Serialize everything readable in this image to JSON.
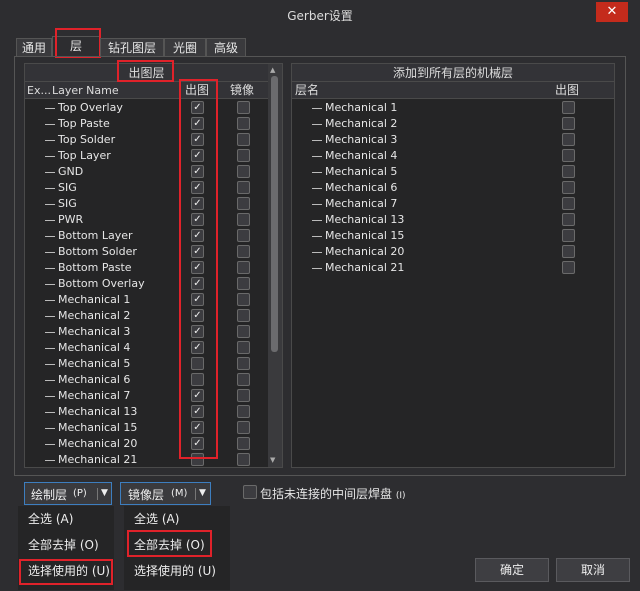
{
  "window": {
    "title": "Gerber设置",
    "close_glyph": "✕"
  },
  "tabs": [
    "通用",
    "层",
    "钻孔图层",
    "光圈",
    "高级"
  ],
  "left_panel": {
    "group_header": "出图层",
    "col_expand": "Ex...",
    "col_name": "Layer Name",
    "col_plot": "出图",
    "col_mirror": "镜像",
    "layers": [
      {
        "name": "Top Overlay",
        "plot": true,
        "mirror": false
      },
      {
        "name": "Top Paste",
        "plot": true,
        "mirror": false
      },
      {
        "name": "Top Solder",
        "plot": true,
        "mirror": false
      },
      {
        "name": "Top Layer",
        "plot": true,
        "mirror": false
      },
      {
        "name": "GND",
        "plot": true,
        "mirror": false
      },
      {
        "name": "SIG",
        "plot": true,
        "mirror": false
      },
      {
        "name": "SIG",
        "plot": true,
        "mirror": false
      },
      {
        "name": "PWR",
        "plot": true,
        "mirror": false
      },
      {
        "name": "Bottom Layer",
        "plot": true,
        "mirror": false
      },
      {
        "name": "Bottom Solder",
        "plot": true,
        "mirror": false
      },
      {
        "name": "Bottom Paste",
        "plot": true,
        "mirror": false
      },
      {
        "name": "Bottom Overlay",
        "plot": true,
        "mirror": false
      },
      {
        "name": "Mechanical 1",
        "plot": true,
        "mirror": false
      },
      {
        "name": "Mechanical 2",
        "plot": true,
        "mirror": false
      },
      {
        "name": "Mechanical 3",
        "plot": true,
        "mirror": false
      },
      {
        "name": "Mechanical 4",
        "plot": true,
        "mirror": false
      },
      {
        "name": "Mechanical 5",
        "plot": false,
        "mirror": false
      },
      {
        "name": "Mechanical 6",
        "plot": false,
        "mirror": false
      },
      {
        "name": "Mechanical 7",
        "plot": true,
        "mirror": false
      },
      {
        "name": "Mechanical 13",
        "plot": true,
        "mirror": false
      },
      {
        "name": "Mechanical 15",
        "plot": true,
        "mirror": false
      },
      {
        "name": "Mechanical 20",
        "plot": true,
        "mirror": false
      },
      {
        "name": "Mechanical 21",
        "plot": false,
        "mirror": false
      }
    ]
  },
  "right_panel": {
    "header": "添加到所有层的机械层",
    "col_name": "层名",
    "col_plot": "出图",
    "layers": [
      {
        "name": "Mechanical 1",
        "plot": false
      },
      {
        "name": "Mechanical 2",
        "plot": false
      },
      {
        "name": "Mechanical 3",
        "plot": false
      },
      {
        "name": "Mechanical 4",
        "plot": false
      },
      {
        "name": "Mechanical 5",
        "plot": false
      },
      {
        "name": "Mechanical 6",
        "plot": false
      },
      {
        "name": "Mechanical 7",
        "plot": false
      },
      {
        "name": "Mechanical 13",
        "plot": false
      },
      {
        "name": "Mechanical 15",
        "plot": false
      },
      {
        "name": "Mechanical 20",
        "plot": false
      },
      {
        "name": "Mechanical 21",
        "plot": false
      }
    ]
  },
  "bottom": {
    "plot_dropdown": "绘制层",
    "plot_hotkey": "(P)",
    "mirror_dropdown": "镜像层",
    "mirror_hotkey": "(M)",
    "include_unconnected": "包括未连接的中间层焊盘",
    "include_hotkey": "(I)",
    "plot_menu": [
      "全选 (A)",
      "全部去掉 (O)",
      "选择使用的 (U)"
    ],
    "mirror_menu": [
      "全选 (A)",
      "全部去掉 (O)",
      "选择使用的 (U)"
    ],
    "ok": "确定",
    "cancel": "取消",
    "check_glyph": "✓",
    "dropdown_glyph": "▼"
  }
}
